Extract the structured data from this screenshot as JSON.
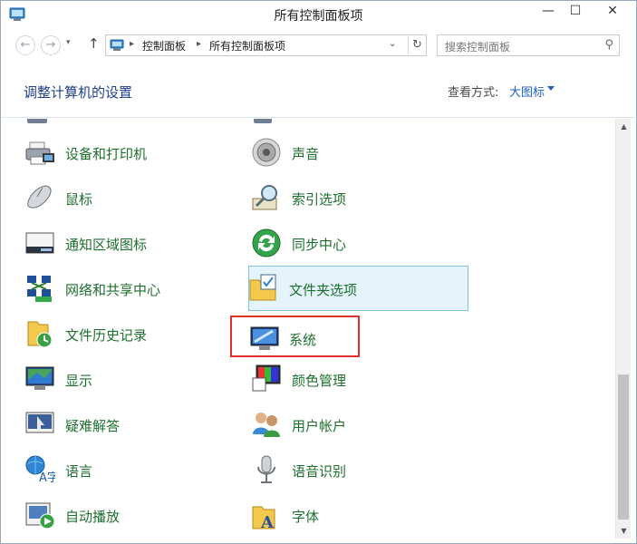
{
  "window": {
    "title": "所有控制面板项",
    "controls": {
      "minimize": "—",
      "maximize": "☐",
      "close": "✕"
    }
  },
  "addressbar": {
    "crumbs": [
      "控制面板",
      "所有控制面板项"
    ],
    "search_placeholder": "搜索控制面板"
  },
  "header": {
    "title": "调整计算机的设置",
    "view_label": "查看方式:",
    "view_value": "大图标"
  },
  "items": [
    {
      "label": "设备和打印机",
      "icon": "printer-icon"
    },
    {
      "label": "声音",
      "icon": "speaker-icon"
    },
    {
      "label": "鼠标",
      "icon": "mouse-icon"
    },
    {
      "label": "索引选项",
      "icon": "index-search-icon"
    },
    {
      "label": "通知区域图标",
      "icon": "taskbar-tray-icon"
    },
    {
      "label": "同步中心",
      "icon": "sync-icon"
    },
    {
      "label": "网络和共享中心",
      "icon": "network-icon"
    },
    {
      "label": "文件夹选项",
      "icon": "folder-options-icon"
    },
    {
      "label": "文件历史记录",
      "icon": "file-history-icon"
    },
    {
      "label": "系统",
      "icon": "system-icon"
    },
    {
      "label": "显示",
      "icon": "display-icon"
    },
    {
      "label": "颜色管理",
      "icon": "color-management-icon"
    },
    {
      "label": "疑难解答",
      "icon": "troubleshooting-icon"
    },
    {
      "label": "用户帐户",
      "icon": "user-accounts-icon"
    },
    {
      "label": "语言",
      "icon": "language-icon"
    },
    {
      "label": "语音识别",
      "icon": "microphone-icon"
    },
    {
      "label": "自动播放",
      "icon": "autoplay-icon"
    },
    {
      "label": "字体",
      "icon": "fonts-icon"
    }
  ],
  "colors": {
    "link_green": "#1e6f2e",
    "title_blue": "#1e3f8a",
    "hover_bg": "#e5f3fb",
    "marker_red": "#e0302c"
  }
}
